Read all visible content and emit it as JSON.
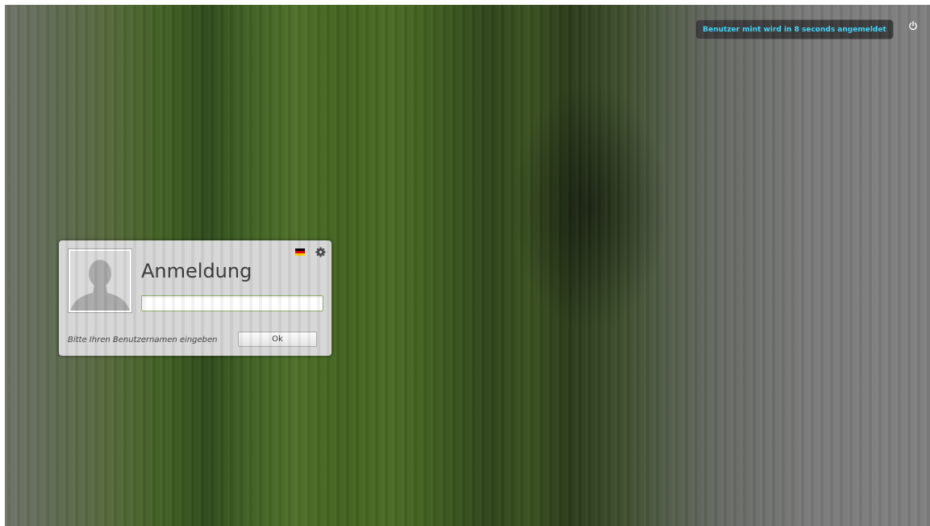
{
  "autologin": {
    "message": "Benutzer mint wird in 8 seconds angemeldet"
  },
  "topbar": {
    "power_icon": "power-icon"
  },
  "login": {
    "title": "Anmeldung",
    "username_value": "",
    "hint": "Bitte Ihren Benutzernamen eingeben",
    "ok_label": "Ok",
    "avatar_icon": "user-silhouette-icon",
    "language_icon": "german-flag-icon",
    "settings_icon": "gear-icon"
  },
  "colors": {
    "autologin_text": "#3fd9ff",
    "panel_background": "#d6d6d6",
    "input_border": "#8fae6a"
  }
}
